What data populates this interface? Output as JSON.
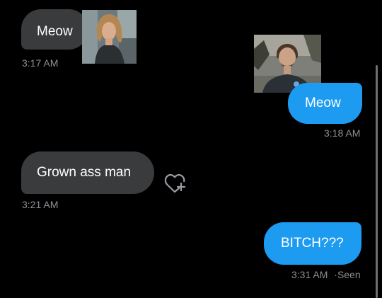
{
  "messages": [
    {
      "direction": "received",
      "text": "Meow",
      "time": "3:17 AM"
    },
    {
      "direction": "sent",
      "text": "Meow",
      "time": "3:18 AM"
    },
    {
      "direction": "received",
      "text": "Grown ass man",
      "time": "3:21 AM"
    },
    {
      "direction": "sent",
      "text": "BITCH???",
      "time": "3:31 AM",
      "status": "Seen"
    }
  ],
  "status_separator": "·",
  "colors": {
    "background": "#000000",
    "received_bubble": "#3a3b3d",
    "sent_bubble": "#1d9bf0",
    "timestamp": "#8b8f94"
  },
  "icons": {
    "react": "heart-plus-icon"
  }
}
